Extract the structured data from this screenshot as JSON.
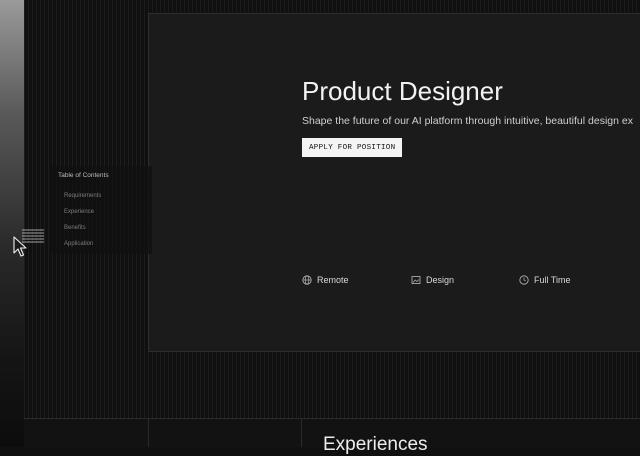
{
  "hero": {
    "title": "Product Designer",
    "subtitle": "Shape the future of our AI platform through intuitive, beautiful design ex",
    "apply_label": "APPLY FOR POSITION"
  },
  "meta": [
    {
      "icon": "globe-icon",
      "label": "Remote"
    },
    {
      "icon": "image-icon",
      "label": "Design"
    },
    {
      "icon": "clock-icon",
      "label": "Full Time"
    }
  ],
  "toc": {
    "title": "Table of Contents",
    "items": [
      "Requirements",
      "Experience",
      "Benefits",
      "Application"
    ]
  },
  "next_section": {
    "heading": "Experiences"
  },
  "colors": {
    "background": "#101010",
    "panel": "#1b1b1b",
    "button": "#f4f4f4",
    "text": "#f2f2f2"
  }
}
